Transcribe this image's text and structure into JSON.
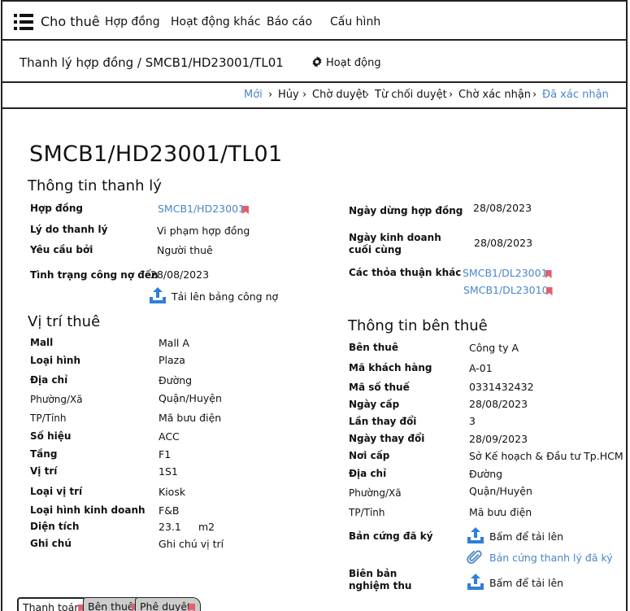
{
  "nav": {
    "brand": "Cho thuê",
    "items": [
      "Hợp đồng",
      "Hoạt động khác",
      "Báo cáo",
      "Cấu hình"
    ]
  },
  "header": {
    "breadcrumb": "Thanh lý hợp đồng / SMCB1/HD23001/TL01",
    "activity": "Hoạt động"
  },
  "statuses": [
    "Mới",
    "Hủy",
    "Chờ duyệt",
    "Từ chối duyệt",
    "Chờ xác nhận",
    "Đã xác nhận"
  ],
  "doc_title": "SMCB1/HD23001/TL01",
  "liquidation": {
    "title": "Thông tin thanh lý",
    "contract_label": "Hợp đồng",
    "contract_value": "SMCB1/HD23001",
    "reason_label": "Lý do thanh lý",
    "reason_value": "Vi phạm hợp đồng",
    "requested_label": "Yêu cầu bởi",
    "requested_value": "Người thuê",
    "debt_label": "Tình trạng công nợ đến",
    "debt_value": "28/08/2023",
    "upload_debt": "Tải lên bảng công nợ",
    "stop_label": "Ngày dừng hợp đồng",
    "stop_value": "28/08/2023",
    "last_biz_label_1": "Ngày kinh doanh",
    "last_biz_label_2": "cuối cùng",
    "last_biz_value": "28/08/2023",
    "other_label": "Các thỏa thuận khác",
    "other_values": [
      "SMCB1/DL23001",
      "SMCB1/DL23010"
    ]
  },
  "location": {
    "title": "Vị trí thuê",
    "rows": [
      {
        "label": "Mall",
        "value": "Mall A"
      },
      {
        "label": "Loại hình",
        "value": "Plaza"
      },
      {
        "label": "Địa chỉ",
        "value": "Đường"
      },
      {
        "label": "Phường/Xã",
        "value": "Quận/Huyện"
      },
      {
        "label": "TP/Tỉnh",
        "value": "Mã bưu điện"
      },
      {
        "label": "Số hiệu",
        "value": "ACC"
      },
      {
        "label": "Tầng",
        "value": "F1"
      },
      {
        "label": "Vị trí",
        "value": "1S1"
      },
      {
        "label": "Loại vị trí",
        "value": "Kiosk"
      },
      {
        "label": "Loại hình kinh doanh",
        "value": "F&B"
      },
      {
        "label": "Diện tích",
        "value": "23.1",
        "unit": "m2"
      },
      {
        "label": "Ghi chú",
        "value": "Ghi chú vị trí"
      }
    ]
  },
  "tenant": {
    "title": "Thông tin bên thuê",
    "rows": [
      {
        "label": "Bên thuê",
        "value": "Công ty A"
      },
      {
        "label": "Mã khách hàng",
        "value": "A-01"
      },
      {
        "label": "Mã số thuế",
        "value": "0331432432"
      },
      {
        "label": "Ngày cấp",
        "value": "28/08/2023"
      },
      {
        "label": "Lần thay đổi",
        "value": "3"
      },
      {
        "label": "Ngày thay đổi",
        "value": "28/09/2023"
      },
      {
        "label": "Nơi cấp",
        "value": "Sở Kế hoạch & Đầu tư Tp.HCM"
      },
      {
        "label": "Địa chỉ",
        "value": "Đường"
      },
      {
        "label": "Phường/Xã",
        "value": "Quận/Huyện"
      },
      {
        "label": "TP/Tỉnh",
        "value": "Mã bưu điện"
      }
    ],
    "signed_label": "Bản cứng đã ký",
    "signed_upload": "Bấm để tải lên",
    "signed_link": "Bản cứng thanh lý đã ký",
    "acceptance_label_1": "Biên bản",
    "acceptance_label_2": "nghiệm thu",
    "acceptance_upload": "Bấm để tải lên"
  },
  "tabs": [
    "Thanh toán",
    "Bên thuê",
    "Phê duyệt"
  ],
  "colors": {
    "link": "#4a86c8",
    "flag": "#e06070",
    "upload": "#2f7fd8"
  }
}
